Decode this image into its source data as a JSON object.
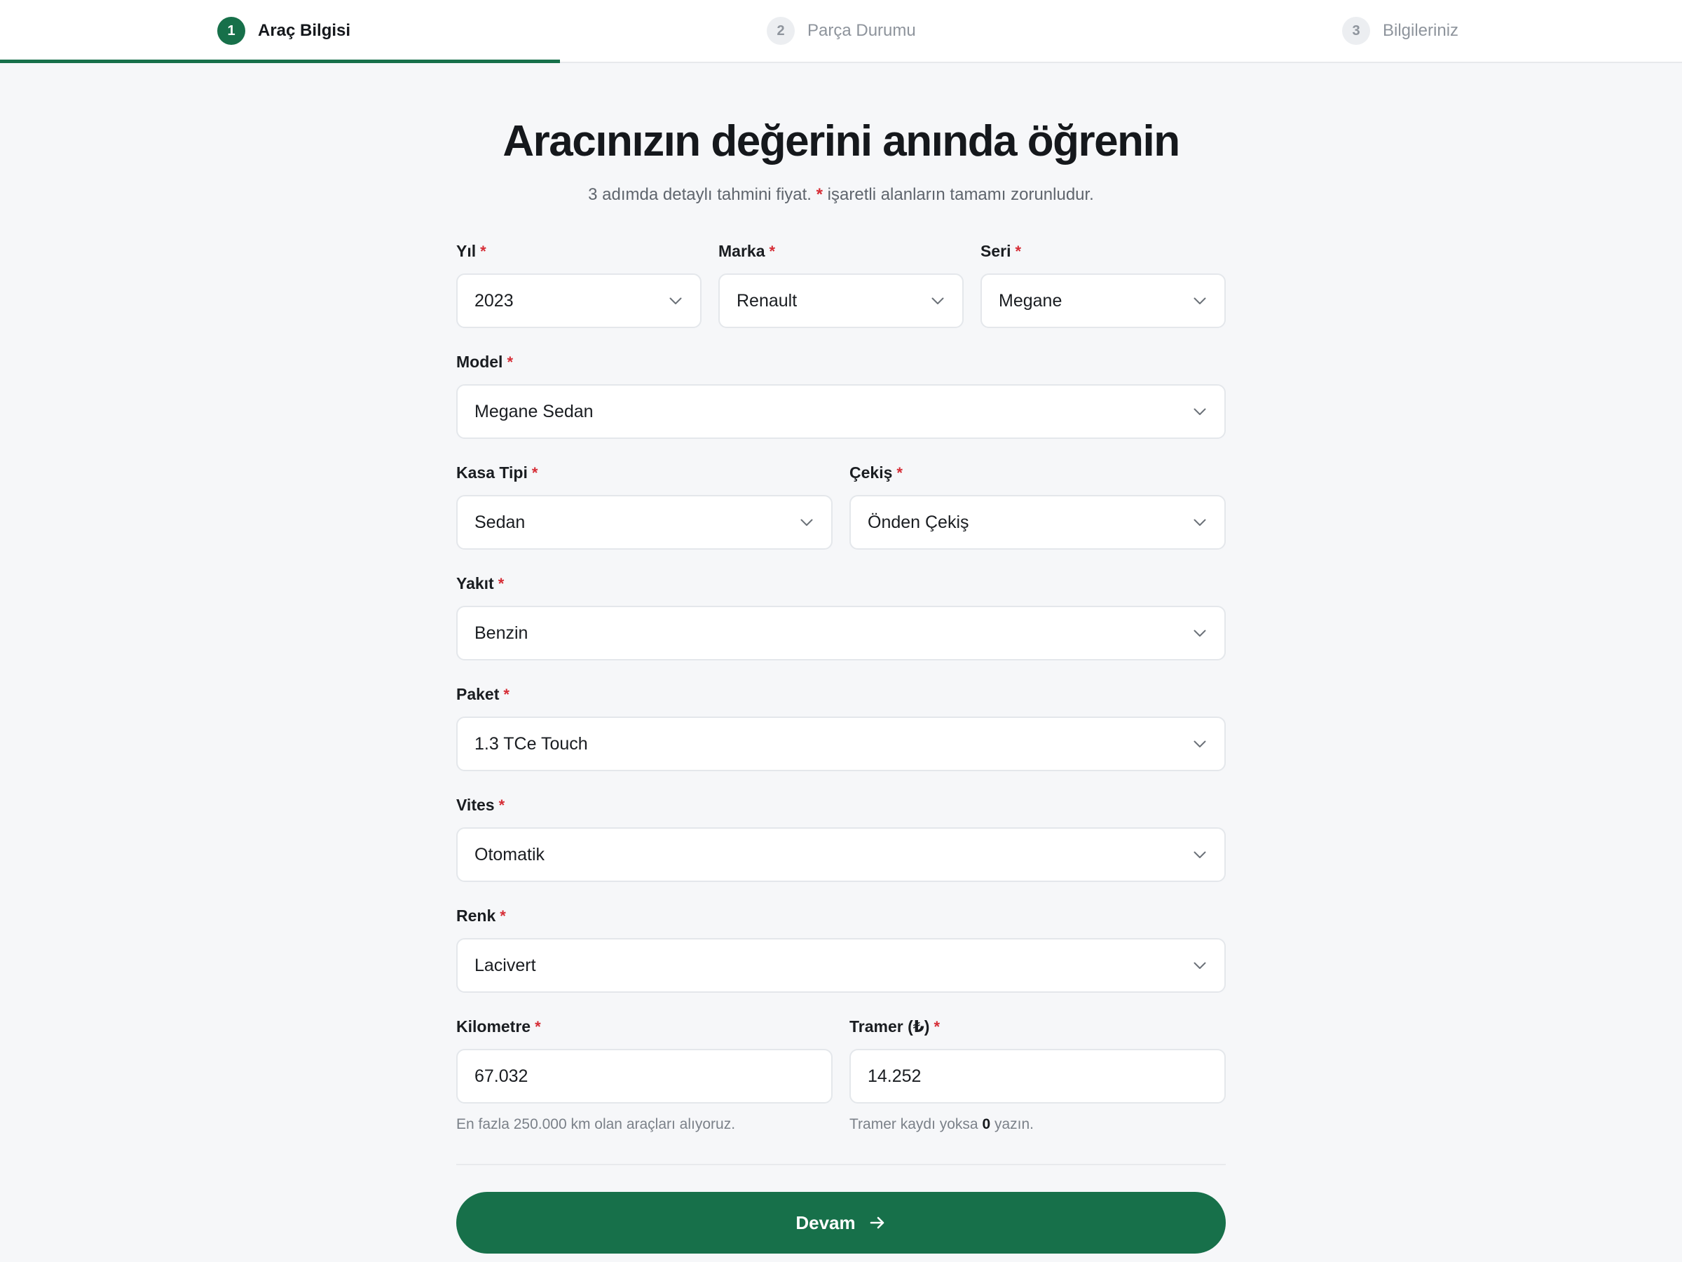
{
  "stepper": {
    "steps": [
      {
        "number": "1",
        "label": "Araç Bilgisi"
      },
      {
        "number": "2",
        "label": "Parça Durumu"
      },
      {
        "number": "3",
        "label": "Bilgileriniz"
      }
    ],
    "progress": 0.333,
    "accent_color": "#17704a"
  },
  "header": {
    "title": "Aracınızın değerini anında öğrenin",
    "subtitle_before": "3 adımda detaylı tahmini fiyat.",
    "subtitle_marker": "*",
    "subtitle_after": "işaretli alanların tamamı zorunludur."
  },
  "required_marker": "*",
  "fields": {
    "yil": {
      "label": "Yıl",
      "value": "2023"
    },
    "marka": {
      "label": "Marka",
      "value": "Renault"
    },
    "seri": {
      "label": "Seri",
      "value": "Megane"
    },
    "model": {
      "label": "Model",
      "value": "Megane Sedan"
    },
    "kasa_tipi": {
      "label": "Kasa Tipi",
      "value": "Sedan"
    },
    "cekis": {
      "label": "Çekiş",
      "value": "Önden Çekiş"
    },
    "yakit": {
      "label": "Yakıt",
      "value": "Benzin"
    },
    "paket": {
      "label": "Paket",
      "value": "1.3 TCe Touch"
    },
    "vites": {
      "label": "Vites",
      "value": "Otomatik"
    },
    "renk": {
      "label": "Renk",
      "value": "Lacivert"
    },
    "kilometre": {
      "label": "Kilometre",
      "value": "67.032",
      "hint": "En fazla 250.000 km olan araçları alıyoruz."
    },
    "tramer": {
      "label": "Tramer (₺)",
      "value": "14.252",
      "hint_before": "Tramer kaydı yoksa",
      "hint_bold": "0",
      "hint_after": "yazın."
    }
  },
  "submit": {
    "label": "Devam",
    "icon": "arrow-right-icon"
  },
  "icons": {
    "select": "chevron-down-icon"
  }
}
